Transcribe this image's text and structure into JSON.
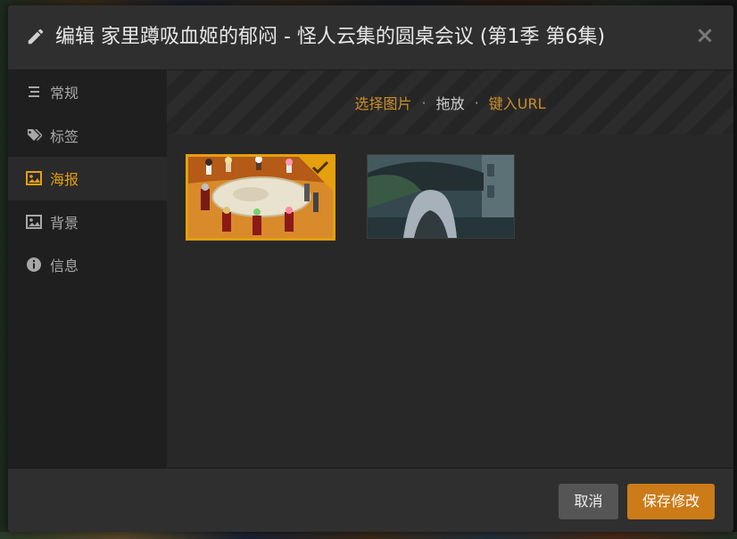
{
  "dialog": {
    "title": "编辑 家里蹲吸血姬的郁闷 - 怪人云集的圆桌会议 (第1季 第6集)",
    "close_label": "×"
  },
  "sidebar": {
    "items": [
      {
        "label": "常规",
        "icon": "list-icon",
        "active": false
      },
      {
        "label": "标签",
        "icon": "tags-icon",
        "active": false
      },
      {
        "label": "海报",
        "icon": "image-icon",
        "active": true
      },
      {
        "label": "背景",
        "icon": "image-icon",
        "active": false
      },
      {
        "label": "信息",
        "icon": "info-icon",
        "active": false
      }
    ]
  },
  "source_bar": {
    "select_image": "选择图片",
    "drag": "拖放",
    "enter_url": "键入URL",
    "separator": "·"
  },
  "posters": [
    {
      "description": "anime round table meeting",
      "selected": true
    },
    {
      "description": "anime rainy courtyard",
      "selected": false
    }
  ],
  "footer": {
    "cancel_label": "取消",
    "save_label": "保存修改"
  },
  "colors": {
    "accent": "#e5a00d",
    "save_button": "#cc7b19",
    "link": "#cc8e2a"
  }
}
